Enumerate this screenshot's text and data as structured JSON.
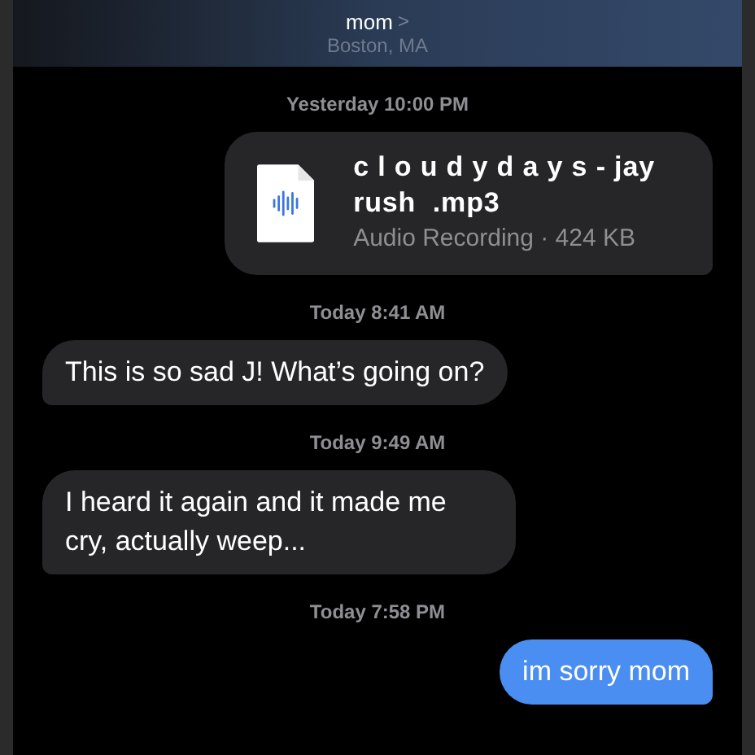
{
  "header": {
    "contact": "mom",
    "chevron": ">",
    "location": "Boston, MA"
  },
  "messages": [
    {
      "timestamp": "Yesterday 10:00 PM",
      "kind": "attachment",
      "outgoing": true,
      "file_name": "c l o u d y d a y s - jay rush  .mp3",
      "file_info": "Audio Recording · 424 KB"
    },
    {
      "timestamp": "Today 8:41 AM",
      "kind": "text",
      "outgoing": false,
      "text": "This is so sad J!  What’s going on?"
    },
    {
      "timestamp": "Today 9:49 AM",
      "kind": "text",
      "outgoing": false,
      "text": "I heard it again and it made me cry, actually weep..."
    },
    {
      "timestamp": "Today 7:58 PM",
      "kind": "text",
      "outgoing": true,
      "text": "im sorry mom"
    }
  ]
}
